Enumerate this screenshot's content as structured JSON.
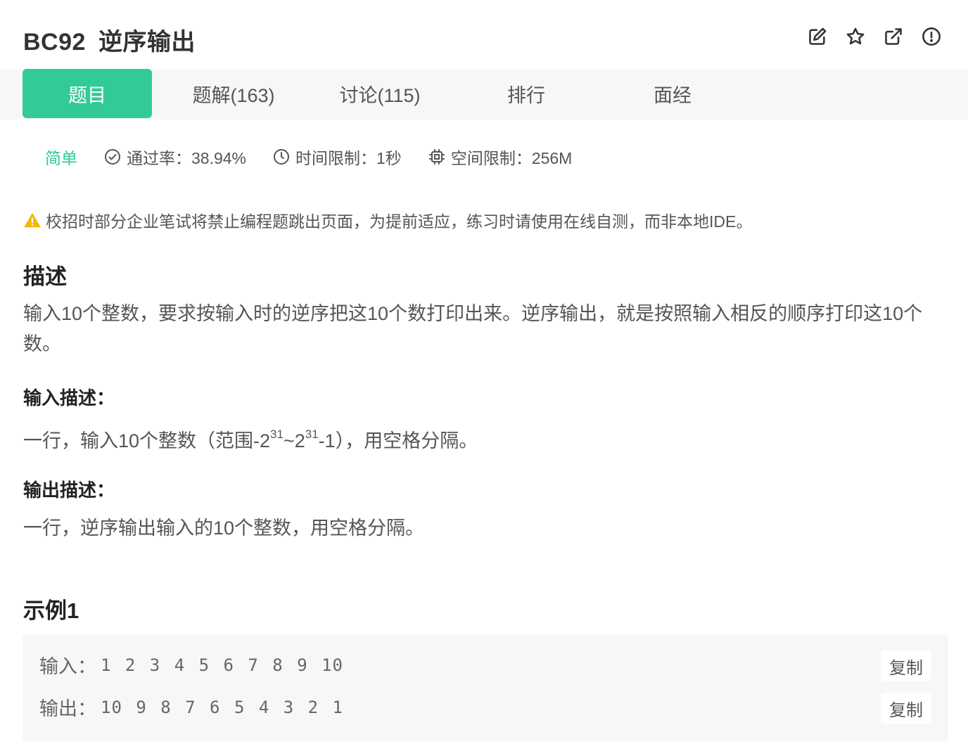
{
  "problem": {
    "code": "BC92",
    "title": "逆序输出"
  },
  "header_icons": [
    "edit-icon",
    "star-icon",
    "external-link-icon",
    "report-icon"
  ],
  "tabs": [
    {
      "label": "题目",
      "active": true
    },
    {
      "label": "题解(163)",
      "active": false
    },
    {
      "label": "讨论(115)",
      "active": false
    },
    {
      "label": "排行",
      "active": false
    },
    {
      "label": "面经",
      "active": false
    }
  ],
  "meta": {
    "level": "简单",
    "pass_rate": "通过率：38.94%",
    "time_limit": "时间限制：1秒",
    "memory_limit": "空间限制：256M"
  },
  "warning": "校招时部分企业笔试将禁止编程题跳出页面，为提前适应，练习时请使用在线自测，而非本地IDE。",
  "description": {
    "heading": "描述",
    "text": "输入10个整数，要求按输入时的逆序把这10个数打印出来。逆序输出，就是按照输入相反的顺序打印这10个数。"
  },
  "input_desc": {
    "heading": "输入描述：",
    "pre": "一行，输入10个整数（范围-2",
    "exp1": "31",
    "mid": "~2",
    "exp2": "31",
    "post": "-1），用空格分隔。"
  },
  "output_desc": {
    "heading": "输出描述：",
    "text": "一行，逆序输出输入的10个整数，用空格分隔。"
  },
  "example": {
    "heading": "示例1",
    "input_label": "输入：",
    "input_value": "1 2 3 4 5 6 7 8 9 10",
    "output_label": "输出：",
    "output_value": "10 9 8 7 6 5 4 3 2 1",
    "copy_label": "复制"
  },
  "colors": {
    "accent": "#32ca99",
    "warning": "#f5b800"
  }
}
